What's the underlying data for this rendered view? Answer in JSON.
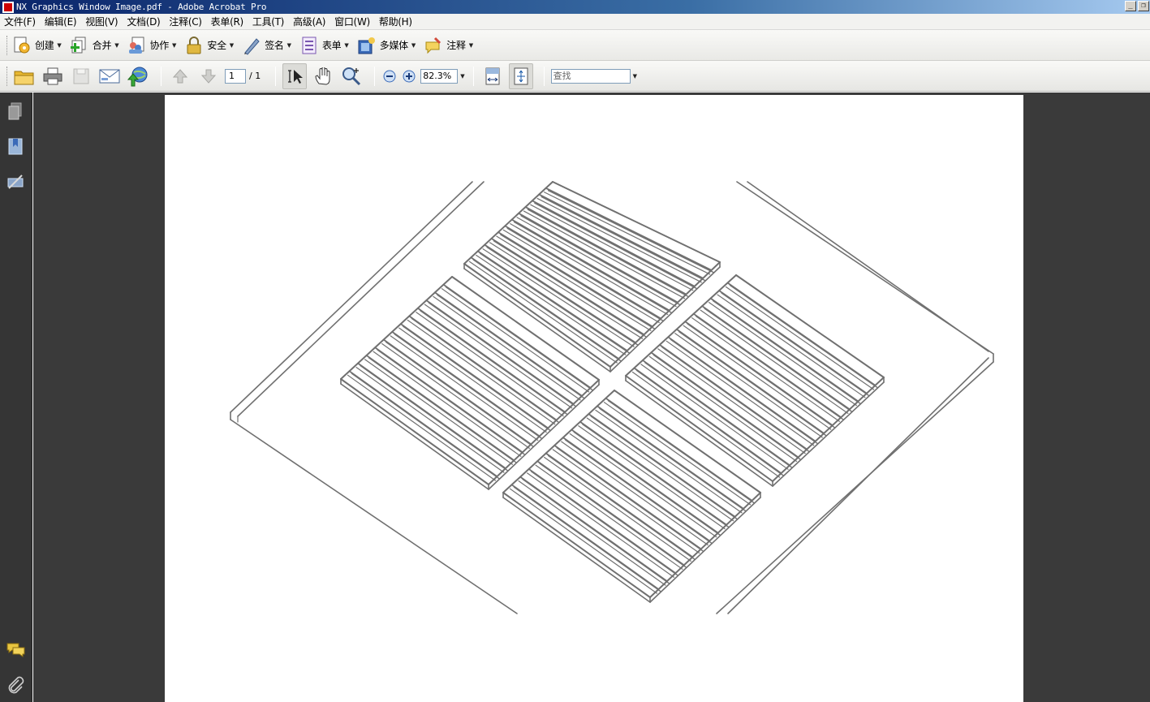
{
  "window": {
    "title": "NX Graphics Window Image.pdf - Adobe Acrobat Pro",
    "minimize": "_",
    "restore": "❐"
  },
  "menu": [
    "文件(F)",
    "编辑(E)",
    "视图(V)",
    "文档(D)",
    "注释(C)",
    "表单(R)",
    "工具(T)",
    "高级(A)",
    "窗口(W)",
    "帮助(H)"
  ],
  "toolbar": {
    "create": "创建",
    "combine": "合并",
    "collaborate": "协作",
    "secure": "安全",
    "sign": "签名",
    "forms": "表单",
    "multimedia": "多媒体",
    "comment": "注释"
  },
  "nav": {
    "current_page": "1",
    "total_pages": "/ 1",
    "zoom": "82.3%",
    "find_placeholder": "查找"
  },
  "colors": {
    "accent_yellow": "#f2c94c",
    "drawing_stroke": "#707070",
    "workspace": "#3a3a3a"
  }
}
